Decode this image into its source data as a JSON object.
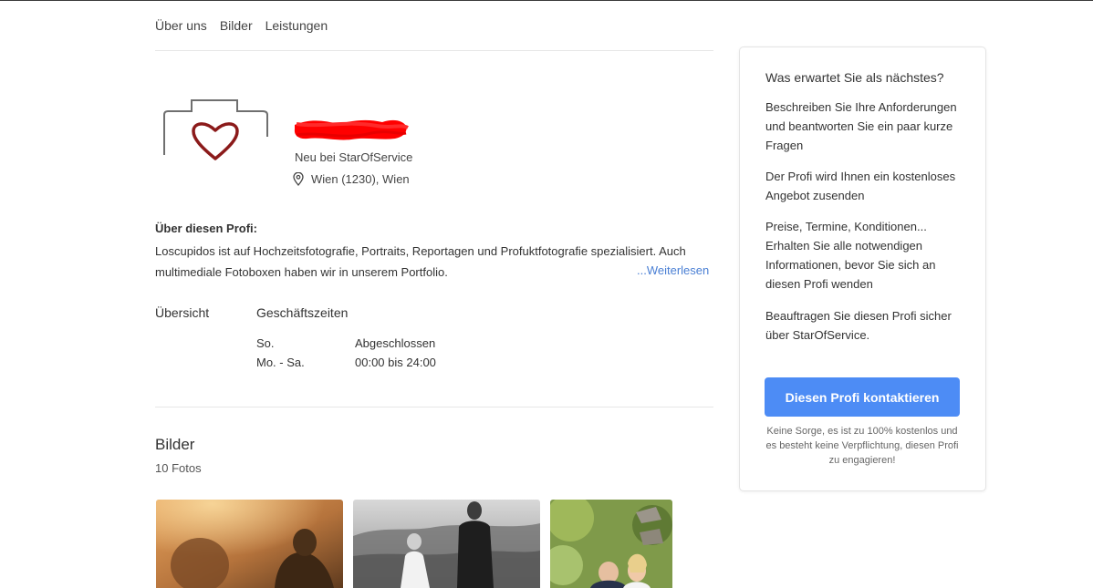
{
  "nav": {
    "items": [
      "Über uns",
      "Bilder",
      "Leistungen"
    ]
  },
  "profile": {
    "subtitle": "Neu bei StarOfService",
    "location": "Wien (1230), Wien"
  },
  "about": {
    "title": "Über diesen Profi:",
    "text": "Loscupidos ist auf Hochzeitsfotografie, Portraits, Reportagen und Profuktfotografie spezialisiert. Auch multimediale Fotoboxen haben wir in unserem Portfolio.",
    "more_link": "...Weiterlesen"
  },
  "tabs": {
    "overview": "Übersicht",
    "hours": "Geschäftszeiten"
  },
  "hours": [
    {
      "day": "So.",
      "time": "Abgeschlossen"
    },
    {
      "day": "Mo. - Sa.",
      "time": "00:00 bis 24:00"
    }
  ],
  "gallery": {
    "title": "Bilder",
    "count": "10 Fotos"
  },
  "sidebar": {
    "title": "Was erwartet Sie als nächstes?",
    "paragraphs": [
      "Beschreiben Sie Ihre Anforderungen und beantworten Sie ein paar kurze Fragen",
      "Der Profi wird Ihnen ein kostenloses Angebot zusenden",
      "Preise, Termine, Konditionen... Erhalten Sie alle notwendigen Informationen, bevor Sie sich an diesen Profi wenden",
      "Beauftragen Sie diesen Profi sicher über StarOfService."
    ],
    "button": "Diesen Profi kontaktieren",
    "note": "Keine Sorge, es ist zu 100% kostenlos und es besteht keine Verpflichtung, diesen Profi zu engagieren!"
  },
  "colors": {
    "accent": "#4d8cf5",
    "link": "#4a7fd4",
    "heart": "#8b1a1a",
    "redaction": "#ff0000"
  },
  "icons": [
    "camera-heart-logo",
    "map-pin-icon"
  ]
}
